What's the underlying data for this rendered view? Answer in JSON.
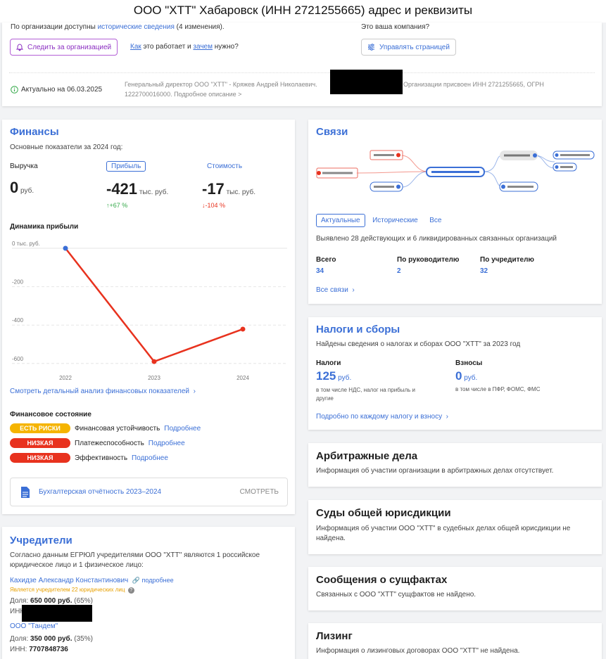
{
  "page_title": "ООО \"ХТТ\" Хабаровск (ИНН 2721255665) адрес и реквизиты",
  "top": {
    "hist_prefix": "По организации доступны",
    "hist_link": "исторические сведения",
    "hist_suffix": "(4 изменения).",
    "follow_label": "Следить за организацией",
    "how_link": "Как",
    "how_mid": "это работает и",
    "why_link": "зачем",
    "why_suffix": "нужно?",
    "your_company": "Это ваша компания?",
    "manage_label": "Управлять страницей",
    "actual": "Актуально на 06.03.2025",
    "summary_1": "Генеральный директор ООО \"ХТТ\" - Кряжев Андрей Николаевич.",
    "summary_2": "Организации присвоен ИНН 2721255665, ОГРН",
    "summary_3": "1222700016000. Подробное описание >"
  },
  "finance": {
    "title": "Финансы",
    "subtitle": "Основные показатели за 2024 год:",
    "revenue_label": "Выручка",
    "revenue_value": "0",
    "revenue_unit": "руб.",
    "profit_label": "Прибыль",
    "profit_value": "-421",
    "profit_unit": "тыс. руб.",
    "profit_change": "↑+67 %",
    "cost_label": "Стоимость",
    "cost_value": "-17",
    "cost_unit": "тыс. руб.",
    "cost_change": "↓-104 %",
    "dynamics_title": "Динамика прибыли",
    "analysis_link": "Смотреть детальный анализ финансовых показателей",
    "state_title": "Финансовое состояние",
    "states": [
      {
        "badge": "ЕСТЬ РИСКИ",
        "color": "#f5b400",
        "label": "Финансовая устойчивость",
        "link": "Подробнее"
      },
      {
        "badge": "НИЗКАЯ",
        "color": "#e8321e",
        "label": "Платежеспособность",
        "link": "Подробнее"
      },
      {
        "badge": "НИЗКАЯ",
        "color": "#e8321e",
        "label": "Эффективность",
        "link": "Подробнее"
      }
    ],
    "report_label": "Бухгалтерская отчётность 2023–2024",
    "report_action": "СМОТРЕТЬ"
  },
  "chart_data": {
    "type": "line",
    "title": "Динамика прибыли",
    "x": [
      "2022",
      "2023",
      "2024"
    ],
    "series": [
      {
        "values": [
          0,
          -590,
          -421
        ]
      }
    ],
    "y_ticks": [
      "0 тыс. руб.",
      "-200",
      "-400",
      "-600"
    ],
    "ylim": [
      -630,
      0
    ],
    "color": "#e8321e",
    "grid": true
  },
  "links": {
    "title": "Связи",
    "tabs": [
      "Актуальные",
      "Исторические",
      "Все"
    ],
    "desc": "Выявлено 28 действующих и 6 ликвидированных связанных организаций",
    "stats": [
      {
        "label": "Всего",
        "value": "34"
      },
      {
        "label": "По руководителю",
        "value": "2"
      },
      {
        "label": "По учредителю",
        "value": "32"
      }
    ],
    "all_link": "Все связи"
  },
  "taxes": {
    "title": "Налоги и сборы",
    "desc": "Найдены сведения о налогах и сборах ООО \"ХТТ\" за 2023 год",
    "tax_label": "Налоги",
    "tax_value": "125",
    "tax_unit": "руб.",
    "tax_note": "в том числе НДС, налог на прибыль и другие",
    "fee_label": "Взносы",
    "fee_value": "0",
    "fee_unit": "руб.",
    "fee_note": "в том числе в ПФР, ФОМС, ФМС",
    "link": "Подробно по каждому налогу и взносу"
  },
  "arbitration": {
    "title": "Арбитражные дела",
    "text": "Информация об участии организации в арбитражных делах отсутствует."
  },
  "courts": {
    "title": "Суды общей юрисдикции",
    "text": "Информация об участии ООО \"ХТТ\" в судебных делах общей юрисдикции не найдена."
  },
  "facts": {
    "title": "Сообщения о сущфактах",
    "text": "Связанных с ООО \"ХТТ\" сущфактов не найдено."
  },
  "leasing": {
    "title": "Лизинг",
    "text": "Информация о лизинговых договорах ООО \"ХТТ\" не найдена."
  },
  "founders": {
    "title": "Учредители",
    "desc": "Согласно данным ЕГРЮЛ учредителями ООО \"ХТТ\" являются 1 российское юридическое лицо и 1 физическое лицо:",
    "person_name": "Кахидзе Александр Константинович",
    "person_more": "подробнее",
    "person_note": "Является учредителем 22 юридических лиц",
    "person_share_label": "Доля:",
    "person_share": "650 000 руб.",
    "person_pct": "(65%)",
    "person_inn_label": "ИНН",
    "org_name": "ООО \"Тандем\"",
    "org_share_label": "Доля:",
    "org_share": "350 000 руб.",
    "org_pct": "(35%)",
    "org_inn_label": "ИНН:",
    "org_inn": "7707848736"
  }
}
